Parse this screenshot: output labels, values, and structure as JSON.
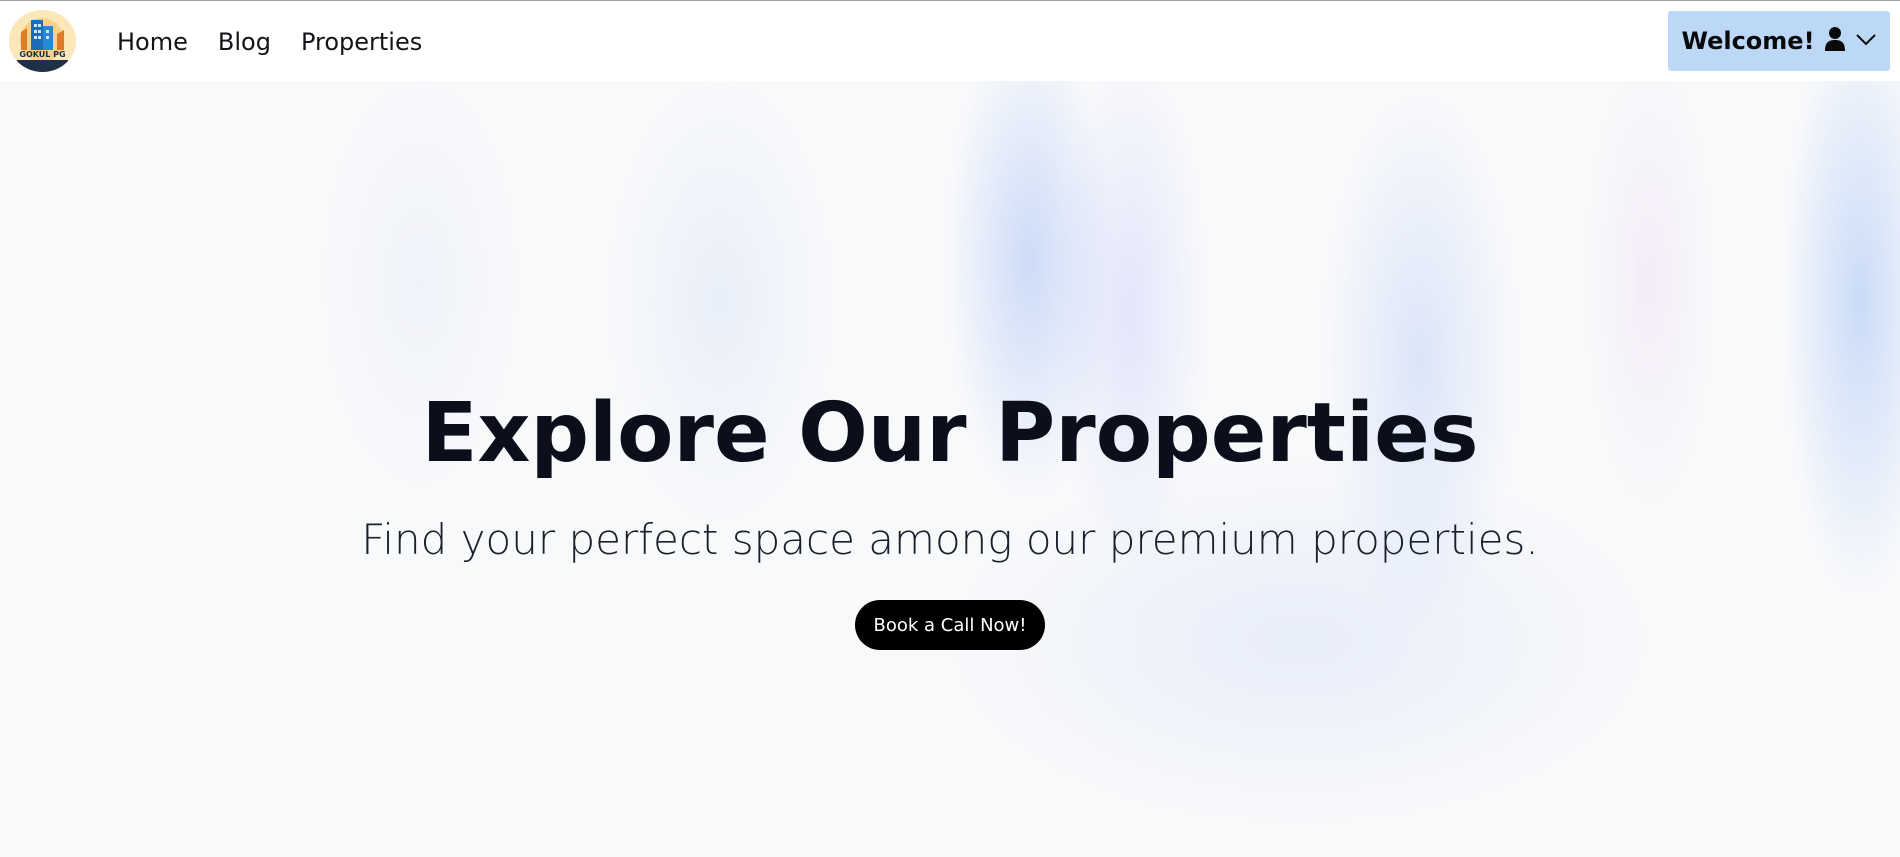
{
  "nav": {
    "logo_text": "GOKUL PG",
    "links": [
      "Home",
      "Blog",
      "Properties"
    ],
    "welcome_label": "Welcome!"
  },
  "hero": {
    "title": "Explore Our Properties",
    "subtitle": "Find your perfect space among our premium properties.",
    "cta_label": "Book a Call Now!"
  },
  "icons": {
    "user": "user-icon",
    "chevron": "chevron-down-icon"
  },
  "colors": {
    "nav_bg": "#ffffff",
    "welcome_bg": "#bcd8f6",
    "cta_bg": "#000000",
    "cta_text": "#ffffff",
    "title_text": "#0b0f1c"
  }
}
